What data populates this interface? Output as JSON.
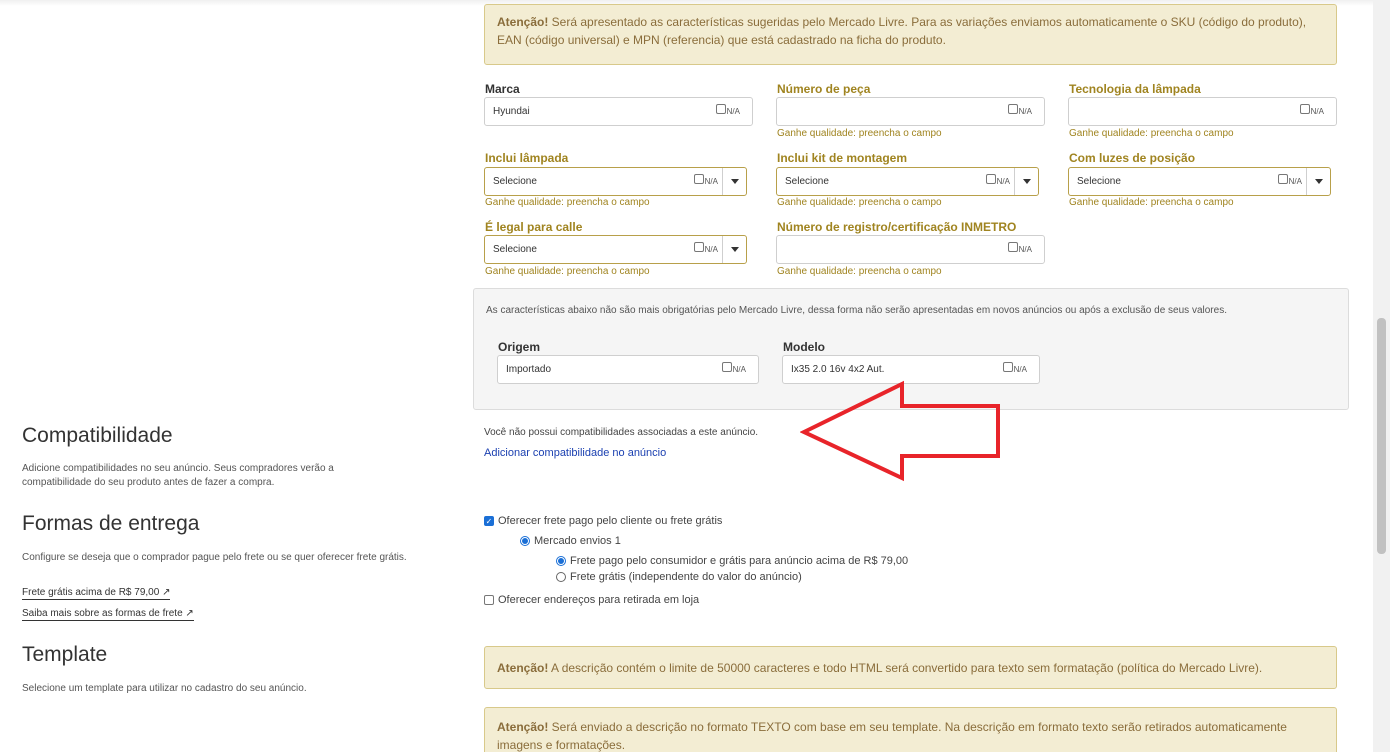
{
  "top_alert": {
    "strong": "Atenção!",
    "text": " Será apresentado as características sugeridas pelo Mercado Livre. Para as variações enviamos automaticamente o SKU (código do produto), EAN (código universal) e MPN (referencia) que está cadastrado na ficha do produto."
  },
  "na_label": "N/A",
  "hint_text": "Ganhe qualidade: preencha o campo",
  "fields": {
    "marca": {
      "label": "Marca",
      "value": "Hyundai"
    },
    "numero_peca": {
      "label": "Número de peça",
      "value": ""
    },
    "tecnologia_lampada": {
      "label": "Tecnologia da lâmpada",
      "value": ""
    },
    "inclui_lampada": {
      "label": "Inclui lâmpada",
      "value": "Selecione"
    },
    "inclui_kit": {
      "label": "Inclui kit de montagem",
      "value": "Selecione"
    },
    "luzes_posicao": {
      "label": "Com luzes de posição",
      "value": "Selecione"
    },
    "legal_calle": {
      "label": "É legal para calle",
      "value": "Selecione"
    },
    "registro_inmetro": {
      "label": "Número de registro/certificação INMETRO",
      "value": ""
    }
  },
  "legacy_panel": {
    "text": "As características abaixo não são mais obrigatórias pelo Mercado Livre, dessa forma não serão apresentadas em novos anúncios ou após a exclusão de seus valores.",
    "origem": {
      "label": "Origem",
      "value": "Importado"
    },
    "modelo": {
      "label": "Modelo",
      "value": "Ix35 2.0 16v 4x2 Aut."
    }
  },
  "compatibilidade": {
    "title": "Compatibilidade",
    "desc": "Adicione compatibilidades no seu anúncio. Seus compradores verão a compatibilidade do seu produto antes de fazer a compra.",
    "empty_text": "Você não possui compatibilidades associadas a este anúncio.",
    "add_link": "Adicionar compatibilidade no anúncio"
  },
  "formas_entrega": {
    "title": "Formas de entrega",
    "desc": "Configure se deseja que o comprador pague pelo frete ou se quer oferecer frete grátis.",
    "link1": "Frete grátis acima de R$ 79,00",
    "link2": "Saiba mais sobre as formas de frete",
    "opt_frete_pago": "Oferecer frete pago pelo cliente ou frete grátis",
    "opt_mercado_envios": "Mercado envios 1",
    "opt_frete_consumidor": "Frete pago pelo consumidor e grátis para anúncio acima de R$ 79,00",
    "opt_frete_gratis": "Frete grátis (independente do valor do anúncio)",
    "opt_retirada": "Oferecer endereços para retirada em loja"
  },
  "template": {
    "title": "Template",
    "desc": "Selecione um template para utilizar no cadastro do seu anúncio.",
    "alert1_strong": "Atenção!",
    "alert1_text": " A descrição contém o limite de 50000 caracteres e todo HTML será convertido para texto sem formatação (política do Mercado Livre).",
    "alert2_strong": "Atenção!",
    "alert2_text": " Será enviado a descrição no formato TEXTO com base em seu template. Na descrição em formato texto serão retirados automaticamente imagens e formatações."
  },
  "colors": {
    "accent_gold": "#a08420",
    "arrow_red": "#e8242a",
    "link_blue": "#1a3fb0"
  }
}
